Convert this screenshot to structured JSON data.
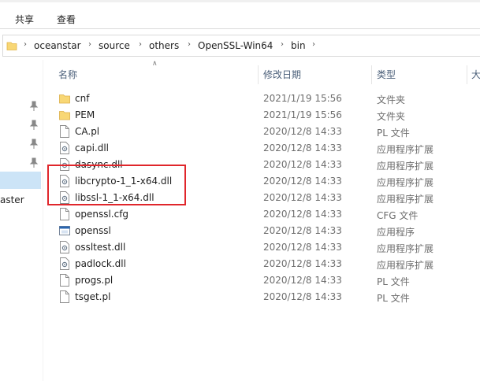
{
  "ribbon": {
    "tabs": [
      "共享",
      "查看"
    ]
  },
  "address": {
    "crumbs": [
      "oceanstar",
      "source",
      "others",
      "OpenSSL-Win64",
      "bin"
    ]
  },
  "nav": {
    "partial_label": "aster"
  },
  "columns": {
    "name": "名称",
    "date": "修改日期",
    "type": "类型",
    "size": "大"
  },
  "files": [
    {
      "name": "cnf",
      "date": "2021/1/19 15:56",
      "type": "文件夹",
      "icon": "folder-icon"
    },
    {
      "name": "PEM",
      "date": "2021/1/19 15:56",
      "type": "文件夹",
      "icon": "folder-icon"
    },
    {
      "name": "CA.pl",
      "date": "2020/12/8 14:33",
      "type": "PL 文件",
      "icon": "file-icon"
    },
    {
      "name": "capi.dll",
      "date": "2020/12/8 14:33",
      "type": "应用程序扩展",
      "icon": "dll-icon"
    },
    {
      "name": "dasync.dll",
      "date": "2020/12/8 14:33",
      "type": "应用程序扩展",
      "icon": "dll-icon"
    },
    {
      "name": "libcrypto-1_1-x64.dll",
      "date": "2020/12/8 14:33",
      "type": "应用程序扩展",
      "icon": "dll-icon"
    },
    {
      "name": "libssl-1_1-x64.dll",
      "date": "2020/12/8 14:33",
      "type": "应用程序扩展",
      "icon": "dll-icon"
    },
    {
      "name": "openssl.cfg",
      "date": "2020/12/8 14:33",
      "type": "CFG 文件",
      "icon": "file-icon"
    },
    {
      "name": "openssl",
      "date": "2020/12/8 14:33",
      "type": "应用程序",
      "icon": "exe-icon"
    },
    {
      "name": "ossltest.dll",
      "date": "2020/12/8 14:33",
      "type": "应用程序扩展",
      "icon": "dll-icon"
    },
    {
      "name": "padlock.dll",
      "date": "2020/12/8 14:33",
      "type": "应用程序扩展",
      "icon": "dll-icon"
    },
    {
      "name": "progs.pl",
      "date": "2020/12/8 14:33",
      "type": "PL 文件",
      "icon": "file-icon"
    },
    {
      "name": "tsget.pl",
      "date": "2020/12/8 14:33",
      "type": "PL 文件",
      "icon": "file-icon"
    }
  ],
  "colors": {
    "folder": "#f8d775",
    "selection": "#cce4f7",
    "highlight_box": "#e0262b"
  }
}
